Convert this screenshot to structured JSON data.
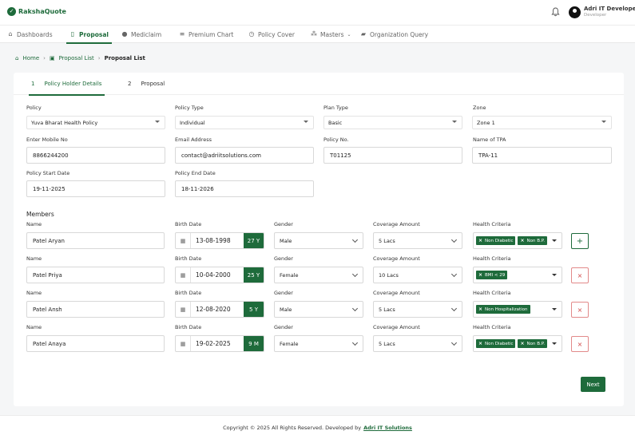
{
  "app": {
    "name": "RakshaQuote"
  },
  "user": {
    "name": "Adri IT Developer",
    "role": "Developer"
  },
  "nav": [
    {
      "label": "Dashboards",
      "icon": "home-icon"
    },
    {
      "label": "Proposal",
      "icon": "document-icon"
    },
    {
      "label": "Mediclaim",
      "icon": "shield-icon"
    },
    {
      "label": "Premium Chart",
      "icon": "list-icon"
    },
    {
      "label": "Policy Cover",
      "icon": "clock-icon"
    },
    {
      "label": "Masters",
      "icon": "layers-icon"
    },
    {
      "label": "Organization Query",
      "icon": "chat-icon"
    }
  ],
  "breadcrumb": {
    "home": "Home",
    "parent": "Proposal List",
    "current": "Proposal List"
  },
  "tabs": [
    {
      "num": "1",
      "label": "Policy Holder Details"
    },
    {
      "num": "2",
      "label": "Proposal"
    }
  ],
  "form": {
    "policy": {
      "label": "Policy",
      "value": "Yuva Bharat Health Policy"
    },
    "policy_type": {
      "label": "Policy Type",
      "value": "Individual"
    },
    "plan_type": {
      "label": "Plan Type",
      "value": "Basic"
    },
    "zone": {
      "label": "Zone",
      "value": "Zone 1"
    },
    "mobile": {
      "label": "Enter Mobile No",
      "value": "8866244200"
    },
    "email": {
      "label": "Email Address",
      "value": "contact@adriitsolutions.com"
    },
    "policy_no": {
      "label": "Policy No.",
      "value": "T01125"
    },
    "tpa": {
      "label": "Name of TPA",
      "value": "TPA-11"
    },
    "start_date": {
      "label": "Policy Start Date",
      "value": "19-11-2025"
    },
    "end_date": {
      "label": "Policy End Date",
      "value": "18-11-2026"
    }
  },
  "members_title": "Members",
  "member_labels": {
    "name": "Name",
    "birth": "Birth Date",
    "gender": "Gender",
    "coverage": "Coverage Amount",
    "health": "Health Criteria"
  },
  "members": [
    {
      "name": "Patel Aryan",
      "birth": "13-08-1998",
      "age": "27 Y",
      "gender": "Male",
      "coverage": "5 Lacs",
      "health": [
        "Non Diabetic",
        "Non B.P."
      ]
    },
    {
      "name": "Patel Priya",
      "birth": "10-04-2000",
      "age": "25 Y",
      "gender": "Female",
      "coverage": "10 Lacs",
      "health": [
        "BMI < 29"
      ]
    },
    {
      "name": "Patel Ansh",
      "birth": "12-08-2020",
      "age": "5 Y",
      "gender": "Male",
      "coverage": "5 Lacs",
      "health": [
        "Non Hospitalization"
      ]
    },
    {
      "name": "Patel Anaya",
      "birth": "19-02-2025",
      "age": "9 M",
      "gender": "Female",
      "coverage": "5 Lacs",
      "health": [
        "Non Diabetic",
        "Non B.P."
      ]
    }
  ],
  "buttons": {
    "add": "+",
    "remove": "×",
    "next": "Next",
    "chip_remove": "×"
  },
  "footer": {
    "text": "Copyright © 2025 All Rights Reserved. Developed by",
    "link": "Adri IT Solutions"
  },
  "colors": {
    "brand": "#1e6b3b",
    "danger": "#d04848"
  }
}
